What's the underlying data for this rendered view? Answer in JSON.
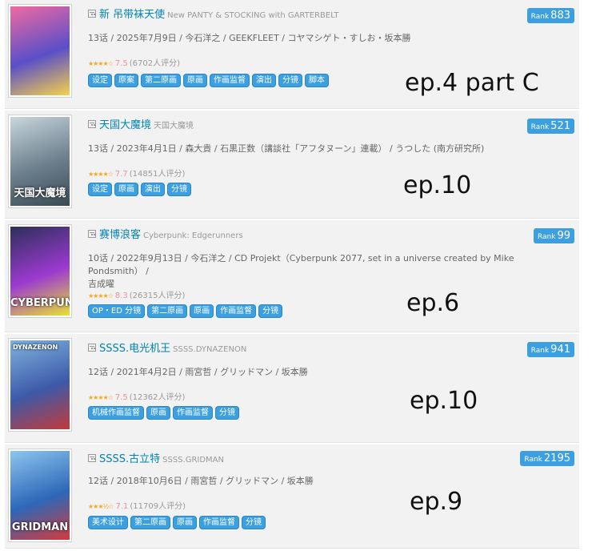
{
  "items": [
    {
      "title": "新 吊带袜天使",
      "original_title": "New PANTY & STOCKING with GARTERBELT",
      "info": "13话 / 2025年7月9日 / 今石洋之 / GEEKFLEET / コヤマシゲト・すしお・坂本勝",
      "info2": "",
      "stars": "★★★★☆",
      "score": "7.5",
      "votes": "(6702人评分)",
      "tags": [
        "设定",
        "原案",
        "第二原画",
        "原画",
        "作画监督",
        "演出",
        "分镜",
        "脚本"
      ],
      "rank_label": "Rank",
      "rank": "883",
      "episode_note": "ep.4 part C",
      "cover_label": "",
      "cover_colors": [
        "#f06aa0",
        "#5a4fc8",
        "#f7d24a"
      ]
    },
    {
      "title": "天国大魔境",
      "original_title": "天国大魔境",
      "info": "13话 / 2023年4月1日 / 森大貴 / 石黒正数（講談社「アフタヌーン」連載） / うつした (南方研究所)",
      "info2": "",
      "stars": "★★★★☆",
      "score": "7.7",
      "votes": "(14851人评分)",
      "tags": [
        "设定",
        "原画",
        "演出",
        "分镜"
      ],
      "rank_label": "Rank",
      "rank": "521",
      "episode_note": "ep.10",
      "cover_label": "天国大魔境",
      "cover_colors": [
        "#c9d6dc",
        "#6b7f8c",
        "#3b4a55"
      ]
    },
    {
      "title": "赛博浪客",
      "original_title": "Cyberpunk: Edgerunners",
      "info": "10话 / 2022年9月13日 / 今石洋之 / CD Projekt（Cyberpunk 2077, set in a universe created by Mike Pondsmith） /",
      "info2": "吉成曜",
      "stars": "★★★★☆",
      "score": "8.3",
      "votes": "(26315人评分)",
      "tags": [
        "OP・ED 分镜",
        "第二原画",
        "原画",
        "作画监督",
        "分镜"
      ],
      "rank_label": "Rank",
      "rank": "99",
      "episode_note": "ep.6",
      "cover_label": "CYBERPUNK",
      "cover_colors": [
        "#2b2f5a",
        "#9c3ad0",
        "#e8e233"
      ]
    },
    {
      "title": "SSSS.电光机王",
      "original_title": "SSSS.DYNAZENON",
      "info": "12话 / 2021年4月2日 / 雨宮哲 / グリッドマン / 坂本勝",
      "info2": "",
      "stars": "★★★★☆",
      "score": "7.5",
      "votes": "(12362人评分)",
      "tags": [
        "机械作画监督",
        "原画",
        "作画监督",
        "分镜"
      ],
      "rank_label": "Rank",
      "rank": "941",
      "episode_note": "ep.10",
      "cover_label": "DYNAZENON",
      "cover_colors": [
        "#7fb3e0",
        "#3d5aa8",
        "#c23a3a"
      ]
    },
    {
      "title": "SSSS.古立特",
      "original_title": "SSSS.GRIDMAN",
      "info": "12话 / 2018年10月6日 / 雨宮哲 / グリッドマン / 坂本勝",
      "info2": "",
      "stars": "★★★½☆",
      "score": "7.1",
      "votes": "(11709人评分)",
      "tags": [
        "美术设计",
        "第二原画",
        "原画",
        "作画监督",
        "分镜"
      ],
      "rank_label": "Rank",
      "rank": "2195",
      "episode_note": "ep.9",
      "cover_label": "GRIDMAN",
      "cover_colors": [
        "#8cc6ee",
        "#2d67b8",
        "#d23b3b"
      ]
    }
  ]
}
